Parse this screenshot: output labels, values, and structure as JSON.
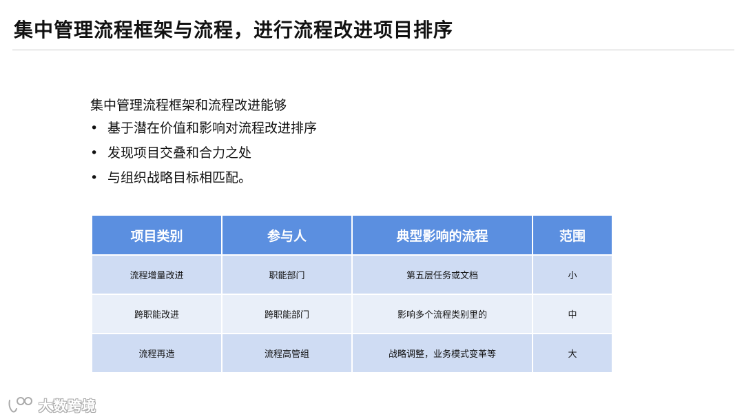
{
  "title": "集中管理流程框架与流程，进行流程改进项目排序",
  "intro": "集中管理流程框架和流程改进能够",
  "bullets": [
    "基于潜在价值和影响对流程改进排序",
    "发现项目交叠和合力之处",
    "与组织战略目标相匹配。"
  ],
  "bullet_symbol": "•",
  "table": {
    "headers": [
      "项目类别",
      "参与人",
      "典型影响的流程",
      "范围"
    ],
    "rows": [
      [
        "流程增量改进",
        "职能部门",
        "第五层任务或文档",
        "小"
      ],
      [
        "跨职能改进",
        "跨职能部门",
        "影响多个流程类别里的",
        "中"
      ],
      [
        "流程再造",
        "流程高管组",
        "战略调整，业务模式变革等",
        "大"
      ]
    ]
  },
  "colors": {
    "header_bg": "#5b8fe0",
    "row_odd": "#cfdcf3",
    "row_even": "#e9eff9"
  },
  "watermark": {
    "text": "大数跨境",
    "icon": "watermark-logo-icon"
  }
}
